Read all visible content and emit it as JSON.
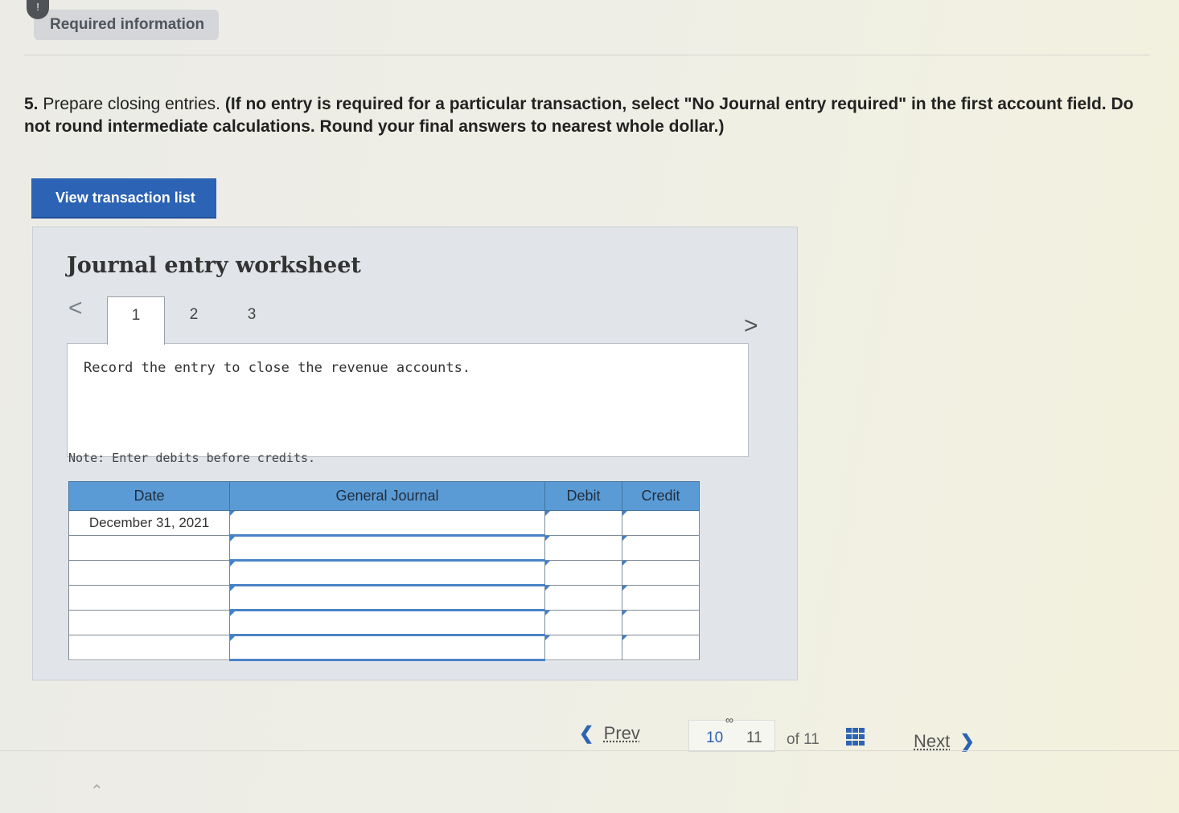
{
  "header": {
    "badge": "!",
    "required_label": "Required information"
  },
  "question": {
    "number": "5.",
    "lead": "Prepare closing entries.",
    "emphasis": "(If no entry is required for a particular transaction, select \"No Journal entry required\" in the first account field. Do not round intermediate calculations. Round your final answers to nearest whole dollar.)"
  },
  "toolbar": {
    "view_transactions_label": "View transaction list"
  },
  "worksheet": {
    "title": "Journal entry worksheet",
    "tabs": [
      "1",
      "2",
      "3"
    ],
    "active_tab": 1,
    "prev_icon": "<",
    "next_icon": ">",
    "instruction": "Record the entry to close the revenue accounts.",
    "note": "Note: Enter debits before credits.",
    "table": {
      "headers": {
        "date": "Date",
        "journal": "General Journal",
        "debit": "Debit",
        "credit": "Credit"
      },
      "rows": [
        {
          "date": "December 31, 2021"
        },
        {
          "date": ""
        },
        {
          "date": ""
        },
        {
          "date": ""
        },
        {
          "date": ""
        },
        {
          "date": ""
        }
      ]
    }
  },
  "pagination": {
    "prev_label": "Prev",
    "next_label": "Next",
    "pages": [
      "10",
      "11"
    ],
    "current_page": "10",
    "of_label": "of 11",
    "prev_icon": "chevron-left-icon",
    "next_icon": "chevron-right-icon",
    "grid_icon": "grid-icon",
    "link_icon": "link-icon"
  },
  "colors": {
    "accent": "#2c63b4",
    "table_header": "#5b9bd5"
  }
}
